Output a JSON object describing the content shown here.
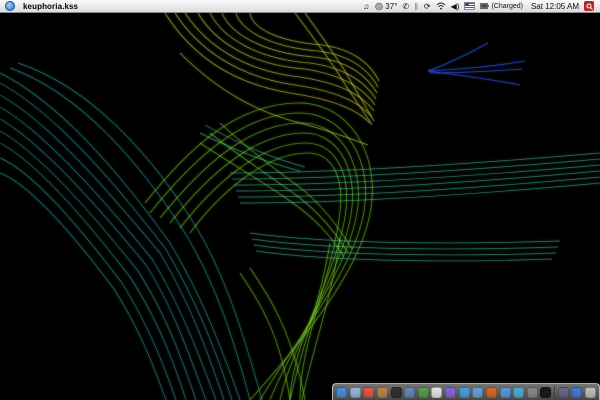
{
  "menubar": {
    "apple_icon": "apple-logo-icon",
    "app_name": "keuphoria.kss",
    "extras": {
      "music_icon": "♫",
      "weather_temp": "37°",
      "phone_icon": "✆",
      "bluetooth_icon": "ᛒ",
      "sync_icon": "⟳",
      "wifi_icon": "wifi",
      "volume_icon": "◀)",
      "flag_icon": "us-flag-icon",
      "battery_text": "(Charged)",
      "clock": "Sat 12:05 AM",
      "spotlight_icon": "spotlight-icon"
    }
  },
  "colors": {
    "menubar_top": "#fafafa",
    "menubar_bottom": "#dcdcdc",
    "art_cyan": "#3fd0c8",
    "art_green": "#7ed82a",
    "art_yellow": "#d9e83a",
    "art_blue": "#2b4fd8"
  },
  "dock": {
    "items": [
      {
        "name": "finder-icon",
        "color": "#4d8fd8"
      },
      {
        "name": "mail-icon",
        "color": "#9bb7d8"
      },
      {
        "name": "calendar-icon",
        "color": "#e05a4a"
      },
      {
        "name": "address-book-icon",
        "color": "#b88a4a"
      },
      {
        "name": "dashboard-icon",
        "color": "#333333"
      },
      {
        "name": "preview-icon",
        "color": "#6a8ab8"
      },
      {
        "name": "chat-icon",
        "color": "#5aa04a"
      },
      {
        "name": "x11-icon",
        "color": "#e8e8e8"
      },
      {
        "name": "font-icon",
        "color": "#8a6ad8"
      },
      {
        "name": "safari-icon",
        "color": "#4aa0e0"
      },
      {
        "name": "network-icon",
        "color": "#6aa0d8"
      },
      {
        "name": "firefox-icon",
        "color": "#d86a2a"
      },
      {
        "name": "itunes-icon",
        "color": "#5a9ad8"
      },
      {
        "name": "iphoto-icon",
        "color": "#4ab0d8"
      },
      {
        "name": "gear-icon",
        "color": "#8a8a8a"
      },
      {
        "name": "terminal-icon",
        "color": "#1a1a1a"
      },
      {
        "name": "system-prefs-icon",
        "color": "#6a6a8a"
      },
      {
        "name": "documents-icon",
        "color": "#4a7ad8"
      },
      {
        "name": "trash-icon",
        "color": "#c0c0c0"
      }
    ]
  }
}
